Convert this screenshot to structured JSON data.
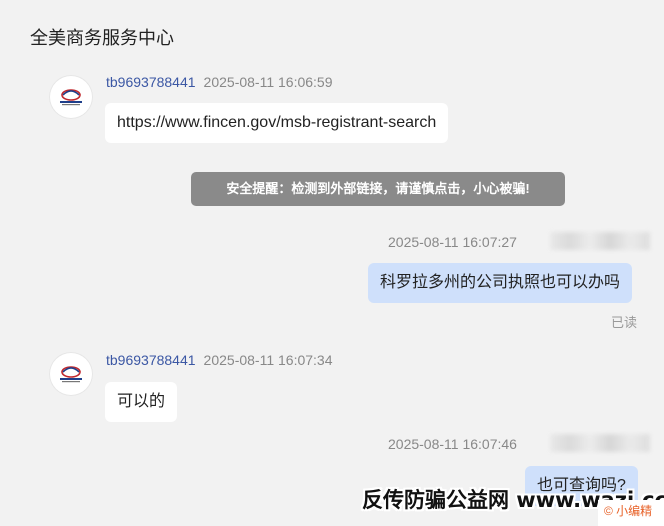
{
  "header": {
    "title": "全美商务服务中心"
  },
  "messages": [
    {
      "sender": "tb9693788441",
      "time": "2025-08-11 16:06:59",
      "text": "https://www.fincen.gov/msb-registrant-search"
    },
    {
      "sender": "tb9693788441",
      "time": "2025-08-11 16:07:34",
      "text": "可以的"
    }
  ],
  "warning": "安全提醒：检测到外部链接，请谨慎点击，小心被骗!",
  "outgoing": [
    {
      "time": "2025-08-11 16:07:27",
      "text": "科罗拉多州的公司执照也可以办吗",
      "status": "已读"
    },
    {
      "time": "2025-08-11 16:07:46",
      "text": "也可查询吗?"
    }
  ],
  "watermark": "反传防骗公益网 www.wazi.cc",
  "corner_badge": "© 小编精",
  "colors": {
    "background": "#f2f2f2",
    "sender_name": "#3b57a4",
    "outgoing_bubble": "#cfe0fb",
    "warning_bg": "#8a8a8a",
    "badge_text": "#e8632a"
  }
}
